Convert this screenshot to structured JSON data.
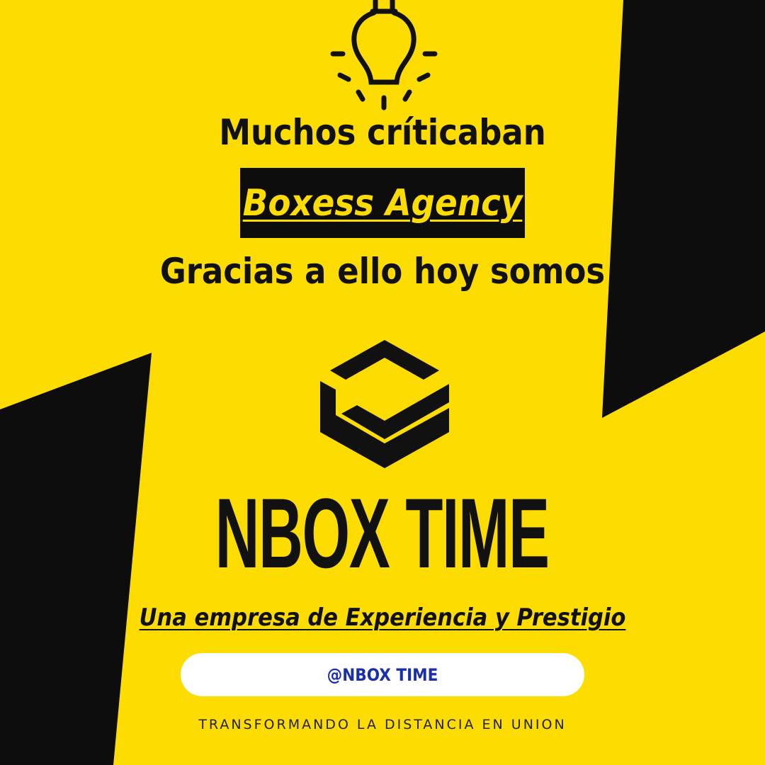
{
  "colors": {
    "background": "#FDDC02",
    "shapes": "#0d0d0d",
    "accent_text": "#FDDC02",
    "handle_text": "#1a2fb0",
    "pill": "#ffffff"
  },
  "icons": {
    "top": "lightbulb-icon",
    "logo": "nbox-stacked-box-icon"
  },
  "headline_top": "Muchos críticaban",
  "agency_name": "Boxess Agency",
  "headline_bottom": "Gracias a ello hoy somos",
  "brand_name": "NBOX TIME",
  "tagline": "Una empresa de Experiencia y Prestigio",
  "handle": "@NBOX TIME",
  "footer": "TRANSFORMANDO LA DISTANCIA EN UNION"
}
